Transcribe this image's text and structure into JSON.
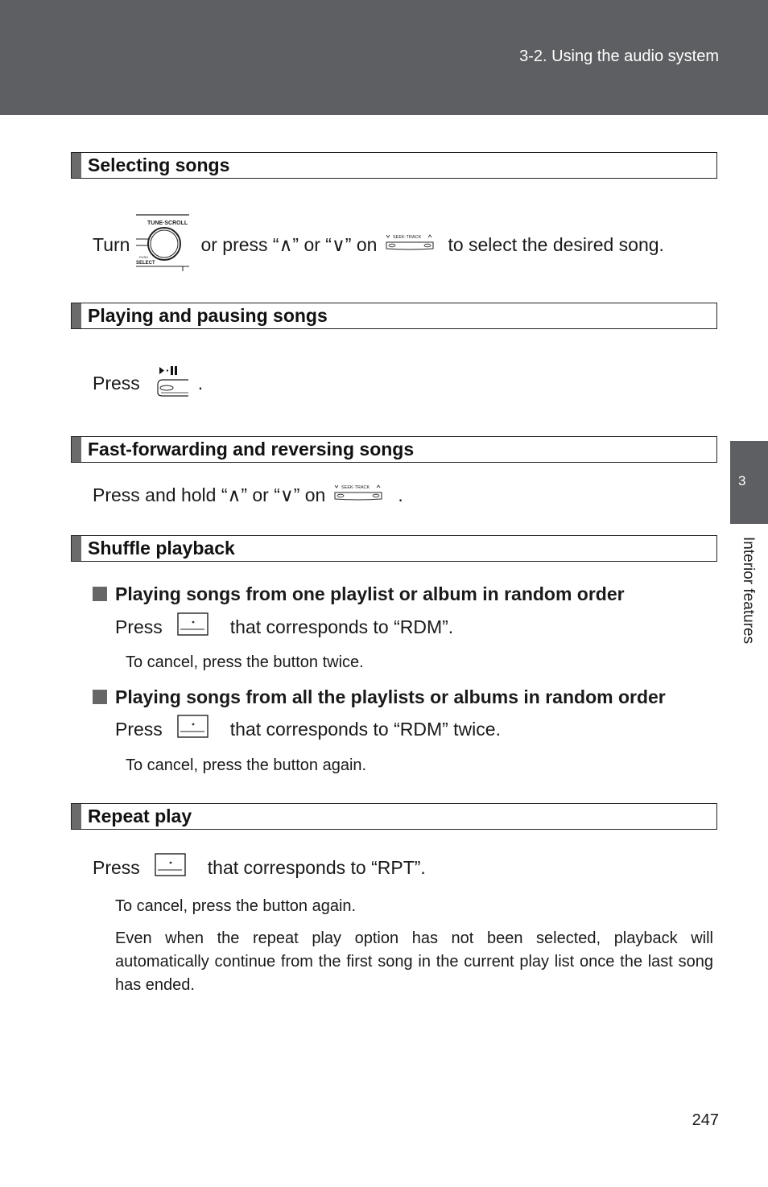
{
  "header": {
    "title": "3-2. Using the audio system"
  },
  "side_tab": {
    "number": "3",
    "label": "Interior features"
  },
  "sections": {
    "selecting": {
      "title": "Selecting songs",
      "line": {
        "part1": "Turn",
        "part2": "or press “∧” or “∨” on",
        "part3": "to select the desired song."
      },
      "icons": {
        "knob_label": "TUNE·SCROLL",
        "knob_push": "PUSH",
        "knob_select": "SELECT",
        "seek_label": "SEEK·TRACK"
      }
    },
    "playing": {
      "title": "Playing and pausing songs",
      "line": {
        "part1": "Press",
        "part2": "."
      }
    },
    "ffrev": {
      "title": "Fast-forwarding and reversing songs",
      "line": {
        "part1": "Press and hold “∧” or “∨” on",
        "part2": "."
      }
    },
    "shuffle": {
      "title": "Shuffle playback",
      "items": [
        {
          "heading": "Playing songs from one playlist or album in random order",
          "press": "Press",
          "action": "that corresponds to “RDM”.",
          "note": "To cancel, press the button twice."
        },
        {
          "heading": "Playing songs from all the playlists or albums in random order",
          "press": "Press",
          "action": "that corresponds to “RDM” twice.",
          "note": "To cancel, press the button again."
        }
      ]
    },
    "repeat": {
      "title": "Repeat play",
      "press": "Press",
      "action": "that corresponds to “RPT”.",
      "note": "To cancel, press the button again.",
      "paragraph": "Even when the repeat play option has not been selected, playback will automatically continue from the first song in the current play list once the last song has ended."
    }
  },
  "page_number": "247"
}
